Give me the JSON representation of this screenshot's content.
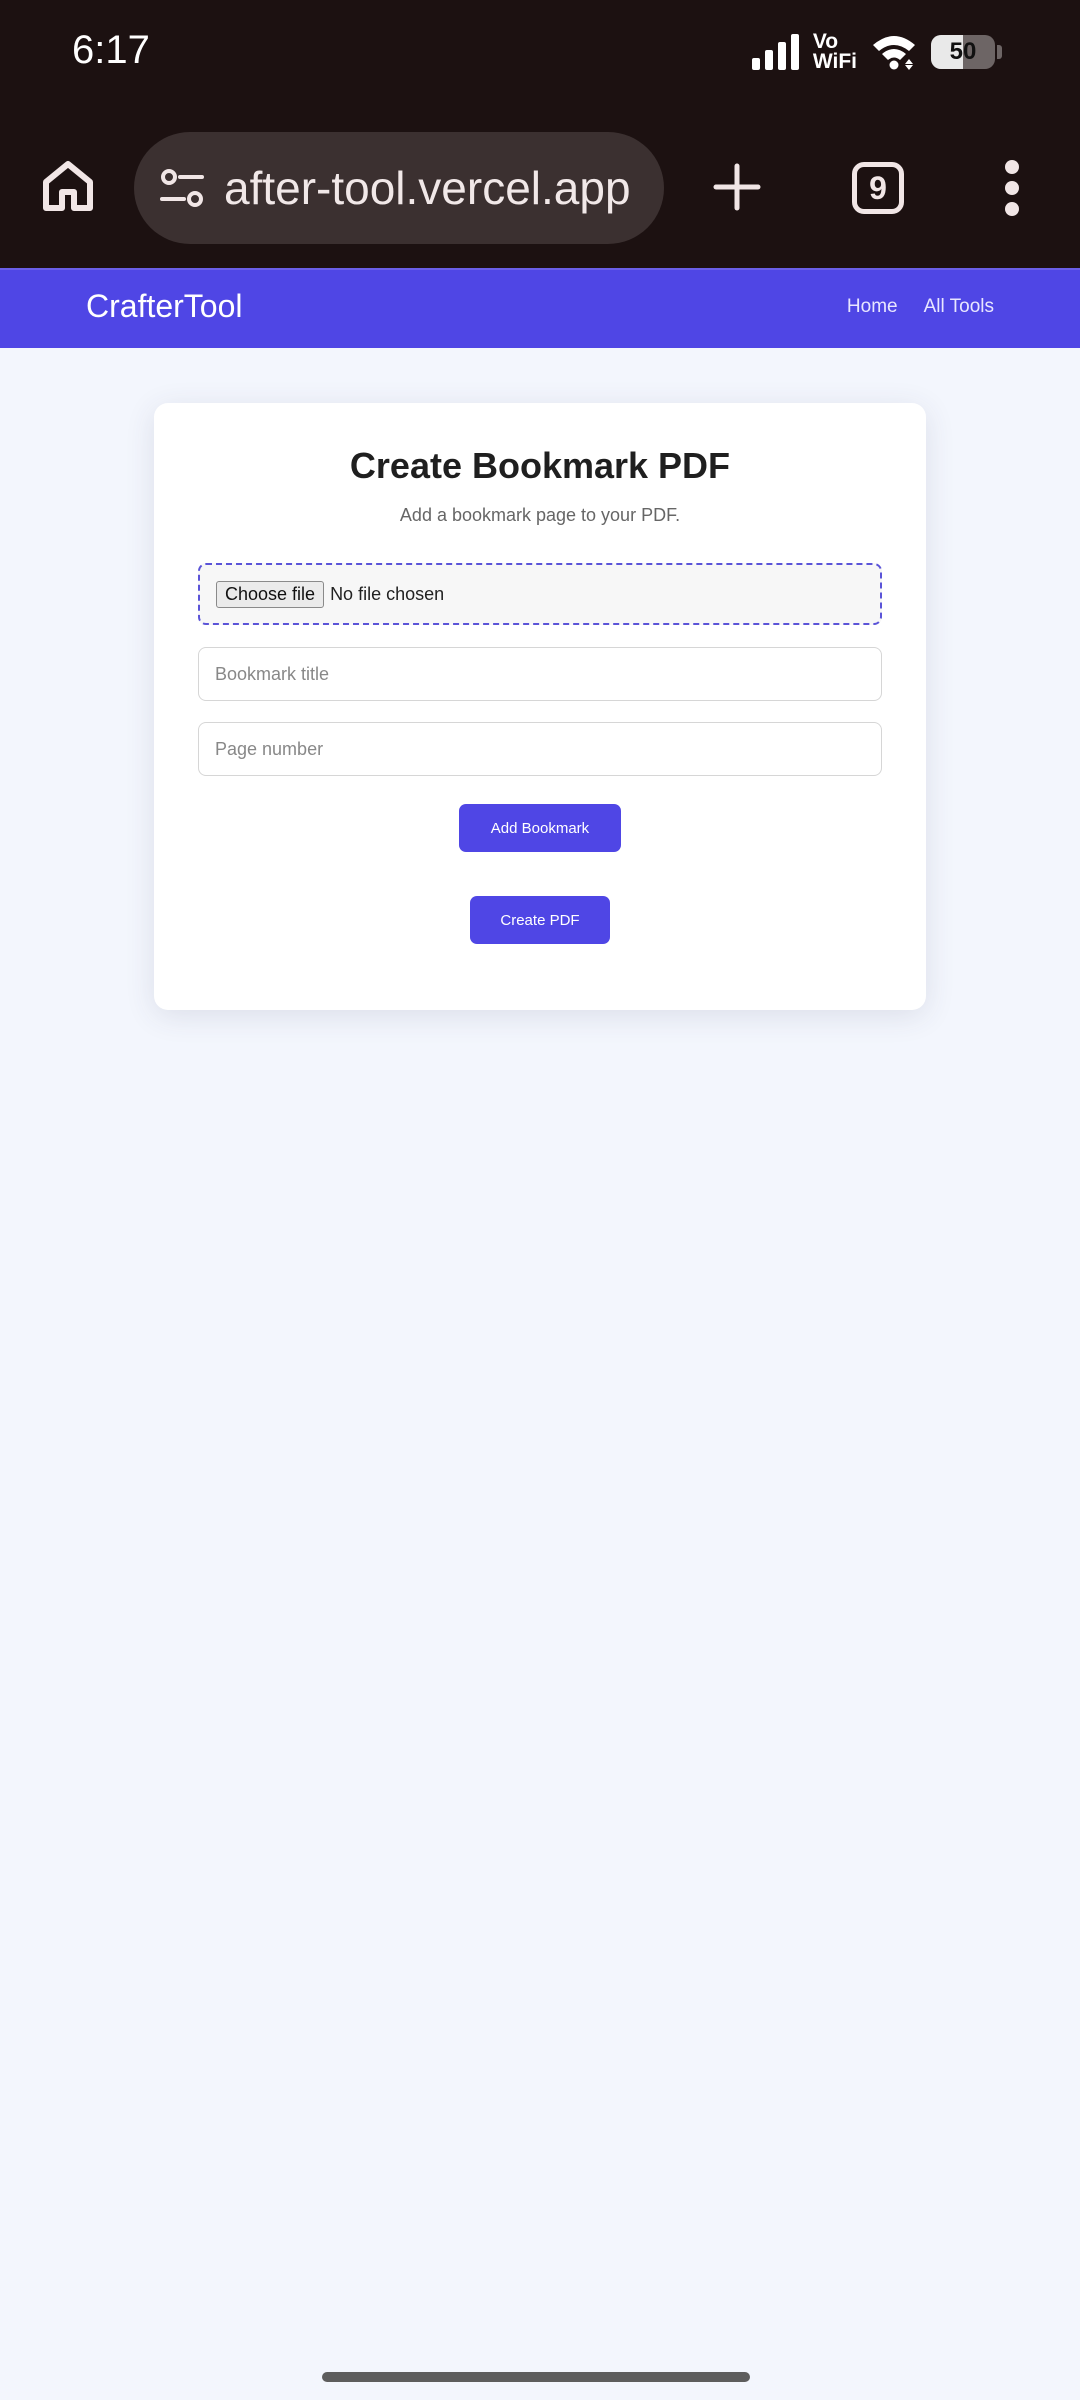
{
  "status_bar": {
    "time": "6:17",
    "network_label_top": "Vo",
    "network_label_bottom": "WiFi",
    "battery": "50",
    "icons": [
      "signal-icon",
      "wifi-icon",
      "battery-icon"
    ]
  },
  "browser": {
    "url": "after-tool.vercel.app",
    "tab_count": "9",
    "icons": [
      "home-icon",
      "site-settings-icon",
      "new-tab-icon",
      "tab-switcher-icon",
      "more-menu-icon"
    ]
  },
  "navbar": {
    "brand": "CrafterTool",
    "links": [
      "Home",
      "All Tools"
    ],
    "color": "#4f46e5"
  },
  "card": {
    "title": "Create Bookmark PDF",
    "subtitle": "Add a bookmark page to your PDF.",
    "file_input": {
      "button_label": "Choose file",
      "status": "No file chosen"
    },
    "bookmark_title_input": {
      "value": "",
      "placeholder": "Bookmark title"
    },
    "page_number_input": {
      "value": "",
      "placeholder": "Page number"
    },
    "add_button": "Add Bookmark",
    "create_button": "Create PDF"
  }
}
